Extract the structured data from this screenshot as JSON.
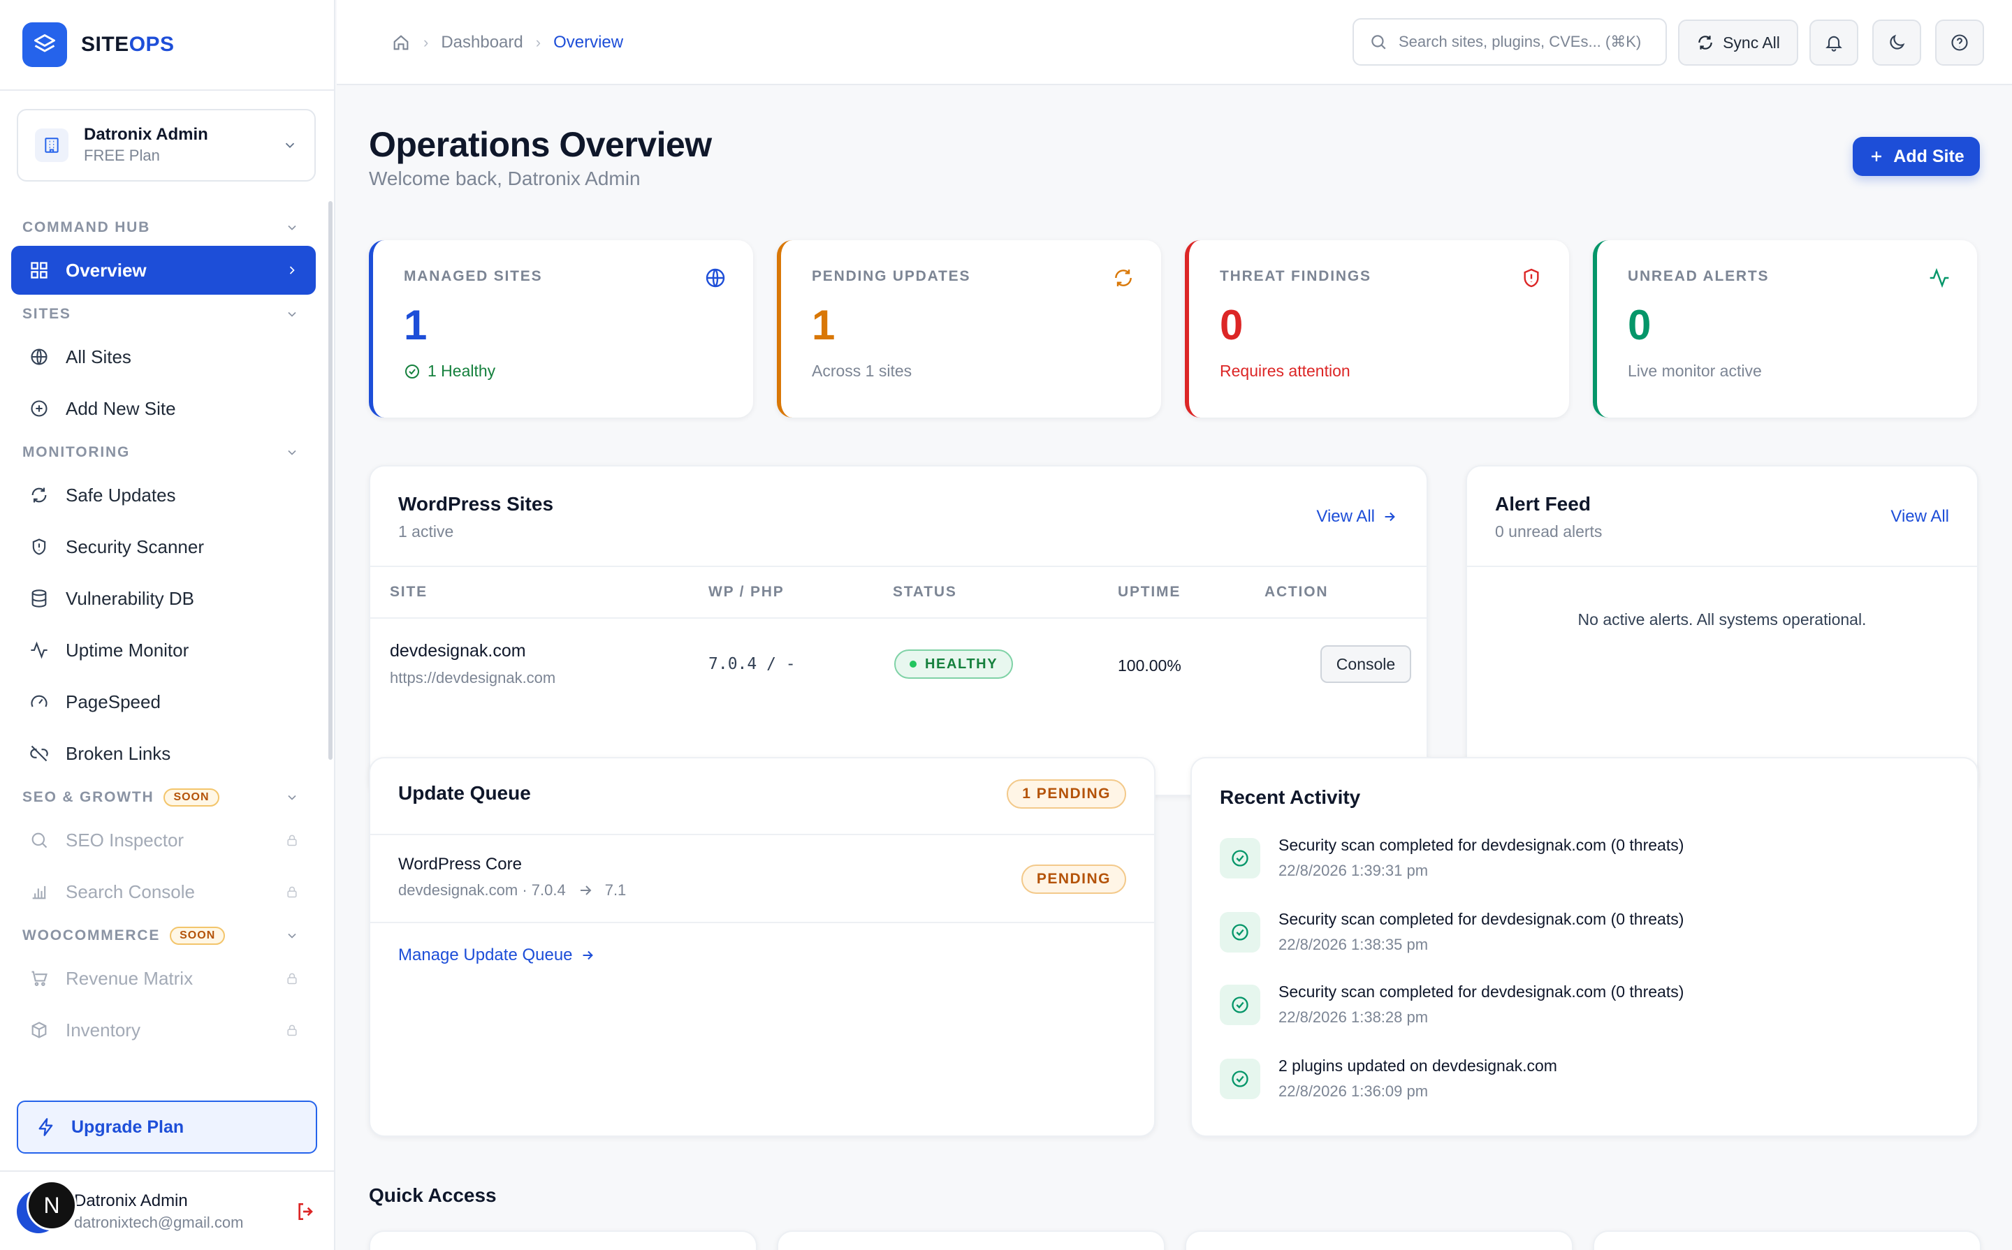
{
  "brand": {
    "prefix": "SITE",
    "suffix": "OPS"
  },
  "org": {
    "name": "Datronix Admin",
    "plan": "FREE Plan"
  },
  "nav": {
    "command_hub": "COMMAND HUB",
    "overview": "Overview",
    "sites_section": "SITES",
    "all_sites": "All Sites",
    "add_new_site": "Add New Site",
    "monitoring_section": "MONITORING",
    "safe_updates": "Safe Updates",
    "security_scanner": "Security Scanner",
    "vulnerability_db": "Vulnerability DB",
    "uptime_monitor": "Uptime Monitor",
    "pagespeed": "PageSpeed",
    "broken_links": "Broken Links",
    "seo_section": "SEO & GROWTH",
    "seo_soon": "SOON",
    "seo_inspector": "SEO Inspector",
    "search_console": "Search Console",
    "woo_section": "WOOCOMMERCE",
    "woo_soon": "SOON",
    "revenue_matrix": "Revenue Matrix",
    "inventory": "Inventory"
  },
  "upgrade_label": "Upgrade Plan",
  "user": {
    "badge": "N",
    "name": "Datronix Admin",
    "email": "datronixtech@gmail.com"
  },
  "breadcrumb": {
    "dashboard": "Dashboard",
    "current": "Overview"
  },
  "search": {
    "placeholder": "Search sites, plugins, CVEs... (⌘K)"
  },
  "sync_label": "Sync All",
  "page": {
    "title": "Operations Overview",
    "subtitle": "Welcome back, Datronix Admin",
    "add_site": "Add Site"
  },
  "stats": [
    {
      "label": "MANAGED SITES",
      "value": "1",
      "sub": "1 Healthy",
      "color": "#1d4ed8"
    },
    {
      "label": "PENDING UPDATES",
      "value": "1",
      "sub": "Across 1 sites",
      "color": "#d97706"
    },
    {
      "label": "THREAT FINDINGS",
      "value": "0",
      "sub": "Requires attention",
      "color": "#dc2626"
    },
    {
      "label": "UNREAD ALERTS",
      "value": "0",
      "sub": "Live monitor active",
      "color": "#059669"
    }
  ],
  "wp_sites": {
    "title": "WordPress Sites",
    "subtitle": "1 active",
    "view_all": "View All",
    "columns": [
      "SITE",
      "WP / PHP",
      "STATUS",
      "UPTIME",
      "ACTION"
    ],
    "rows": [
      {
        "name": "devdesignak.com",
        "url": "https://devdesignak.com",
        "versions": "7.0.4 / -",
        "status": "HEALTHY",
        "uptime": "100.00%",
        "action": "Console"
      }
    ]
  },
  "alert_feed": {
    "title": "Alert Feed",
    "subtitle": "0 unread alerts",
    "view_all": "View All",
    "empty": "No active alerts. All systems operational."
  },
  "update_queue": {
    "title": "Update Queue",
    "pending_count": "1 PENDING",
    "item_name": "WordPress Core",
    "item_detail": "devdesignak.com · 7.0.4",
    "item_target": "7.1",
    "item_status": "PENDING",
    "manage_link": "Manage Update Queue"
  },
  "recent_activity": {
    "title": "Recent Activity",
    "items": [
      {
        "text": "Security scan completed for devdesignak.com (0 threats)",
        "time": "22/8/2026 1:39:31 pm"
      },
      {
        "text": "Security scan completed for devdesignak.com (0 threats)",
        "time": "22/8/2026 1:38:35 pm"
      },
      {
        "text": "Security scan completed for devdesignak.com (0 threats)",
        "time": "22/8/2026 1:38:28 pm"
      },
      {
        "text": "2 plugins updated on devdesignak.com",
        "time": "22/8/2026 1:36:09 pm"
      }
    ]
  },
  "quick_access": {
    "title": "Quick Access"
  },
  "colors": {
    "accent": "#1d4ed8",
    "success": "#059669",
    "warning": "#d97706",
    "danger": "#dc2626"
  }
}
